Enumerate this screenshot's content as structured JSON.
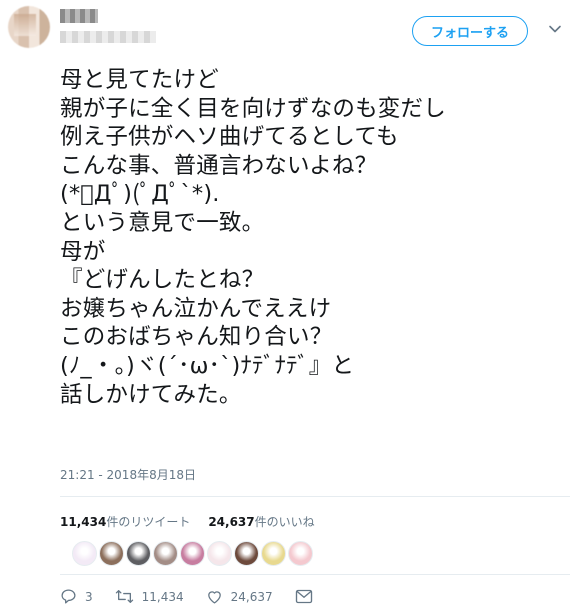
{
  "header": {
    "follow_label": "フォローする"
  },
  "tweet": {
    "lines": [
      "母と見てたけど",
      "親が子に全く目を向けずなのも変だし",
      "例え子供がヘソ曲げてるとしても",
      "こんな事、普通言わないよね？",
      "(*ﾟДﾟ)(ﾟДﾟ`*).",
      "という意見で一致。",
      "母が",
      "『どげんしたとね？",
      "お嬢ちゃん泣かんでええけ",
      "このおばちゃん知り合い？",
      "(ﾉ_・。)ヾ(´･ω･`)ﾅﾃﾞﾅﾃﾞ』と",
      "話しかけてみた。"
    ],
    "timestamp": "21:21 - 2018年8月18日"
  },
  "stats": {
    "retweets_count": "11,434",
    "retweets_label": "件のリツイート",
    "likes_count": "24,637",
    "likes_label": "件のいいね"
  },
  "likers": [
    {
      "icon": "liker-avatar",
      "color": "#f3eaf6"
    },
    {
      "icon": "liker-avatar",
      "color": "#8c6f5c"
    },
    {
      "icon": "liker-avatar",
      "color": "#5e5e62"
    },
    {
      "icon": "liker-avatar",
      "color": "#a38d86"
    },
    {
      "icon": "liker-avatar",
      "color": "#c77da0"
    },
    {
      "icon": "liker-avatar",
      "color": "#f5e6ea"
    },
    {
      "icon": "liker-avatar",
      "color": "#6d4a3c"
    },
    {
      "icon": "liker-avatar",
      "color": "#e8d98f"
    },
    {
      "icon": "liker-avatar",
      "color": "#f4c9cf"
    }
  ],
  "actions": {
    "reply_count": "3",
    "retweet_count": "11,434",
    "like_count": "24,637"
  },
  "colors": {
    "accent": "#1da1f2",
    "muted": "#657786"
  }
}
